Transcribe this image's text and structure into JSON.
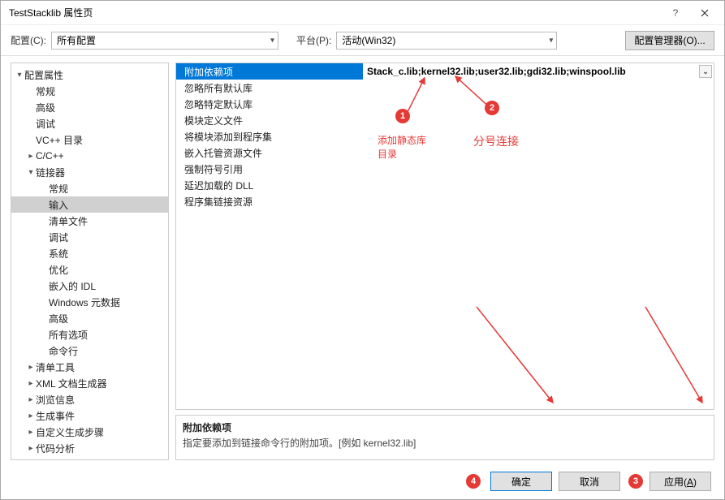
{
  "title": "TestStacklib 属性页",
  "toolbar": {
    "config_label": "配置(C):",
    "config_value": "所有配置",
    "platform_label": "平台(P):",
    "platform_value": "活动(Win32)",
    "manager_button": "配置管理器(O)..."
  },
  "tree": [
    {
      "label": "配置属性",
      "indent": 0,
      "twisty": "▾"
    },
    {
      "label": "常规",
      "indent": 1,
      "twisty": ""
    },
    {
      "label": "高级",
      "indent": 1,
      "twisty": ""
    },
    {
      "label": "调试",
      "indent": 1,
      "twisty": ""
    },
    {
      "label": "VC++ 目录",
      "indent": 1,
      "twisty": ""
    },
    {
      "label": "C/C++",
      "indent": 1,
      "twisty": "▸"
    },
    {
      "label": "链接器",
      "indent": 1,
      "twisty": "▾"
    },
    {
      "label": "常规",
      "indent": 2,
      "twisty": ""
    },
    {
      "label": "输入",
      "indent": 2,
      "twisty": "",
      "selected": true
    },
    {
      "label": "清单文件",
      "indent": 2,
      "twisty": ""
    },
    {
      "label": "调试",
      "indent": 2,
      "twisty": ""
    },
    {
      "label": "系统",
      "indent": 2,
      "twisty": ""
    },
    {
      "label": "优化",
      "indent": 2,
      "twisty": ""
    },
    {
      "label": "嵌入的 IDL",
      "indent": 2,
      "twisty": ""
    },
    {
      "label": "Windows 元数据",
      "indent": 2,
      "twisty": ""
    },
    {
      "label": "高级",
      "indent": 2,
      "twisty": ""
    },
    {
      "label": "所有选项",
      "indent": 2,
      "twisty": ""
    },
    {
      "label": "命令行",
      "indent": 2,
      "twisty": ""
    },
    {
      "label": "清单工具",
      "indent": 1,
      "twisty": "▸"
    },
    {
      "label": "XML 文档生成器",
      "indent": 1,
      "twisty": "▸"
    },
    {
      "label": "浏览信息",
      "indent": 1,
      "twisty": "▸"
    },
    {
      "label": "生成事件",
      "indent": 1,
      "twisty": "▸"
    },
    {
      "label": "自定义生成步骤",
      "indent": 1,
      "twisty": "▸"
    },
    {
      "label": "代码分析",
      "indent": 1,
      "twisty": "▸"
    }
  ],
  "props": [
    {
      "label": "附加依赖项",
      "value": "Stack_c.lib;kernel32.lib;user32.lib;gdi32.lib;winspool.lib",
      "selected": true
    },
    {
      "label": "忽略所有默认库",
      "value": ""
    },
    {
      "label": "忽略特定默认库",
      "value": ""
    },
    {
      "label": "模块定义文件",
      "value": ""
    },
    {
      "label": "将模块添加到程序集",
      "value": ""
    },
    {
      "label": "嵌入托管资源文件",
      "value": ""
    },
    {
      "label": "强制符号引用",
      "value": ""
    },
    {
      "label": "延迟加载的 DLL",
      "value": ""
    },
    {
      "label": "程序集链接资源",
      "value": ""
    }
  ],
  "description": {
    "title": "附加依赖项",
    "text": "指定要添加到链接命令行的附加项。[例如 kernel32.lib]"
  },
  "annotations": {
    "note1_line1": "添加静态库",
    "note1_line2": "目录",
    "note2": "分号连接"
  },
  "footer": {
    "ok": "确定",
    "cancel": "取消",
    "apply_prefix": "应用(",
    "apply_key": "A",
    "apply_suffix": ")"
  }
}
